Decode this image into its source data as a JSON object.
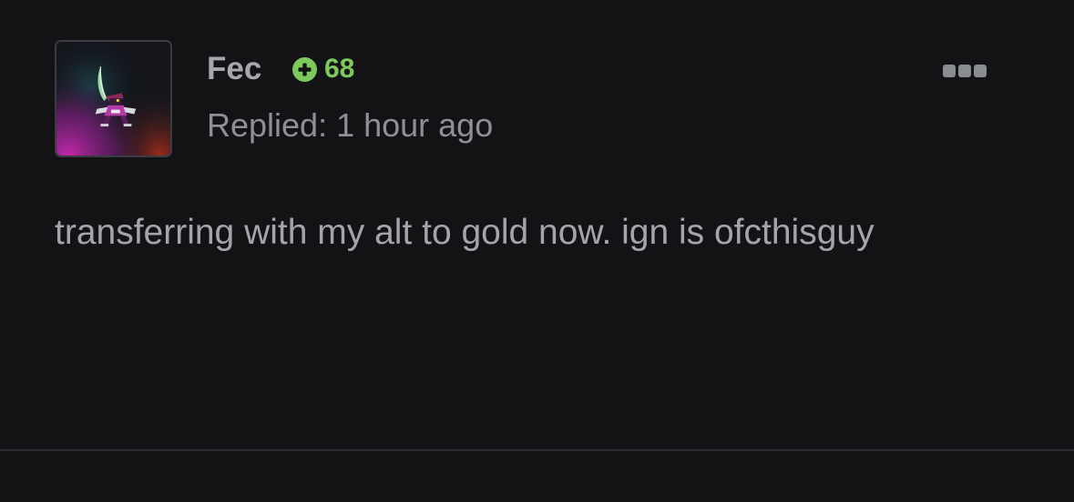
{
  "post": {
    "author": {
      "name": "Fec",
      "reputation": "68"
    },
    "meta": "Replied: 1 hour ago",
    "body": "transferring with my alt to gold now. ign is ofcthisguy"
  },
  "icons": {
    "avatar": "avatar-character-image",
    "reputation": "plus-circle-icon",
    "more": "more-options-icon"
  },
  "colors": {
    "background": "#131316",
    "username": "#a5a8af",
    "reputation": "#7ec95b",
    "meta": "#8e9097",
    "body": "#a3a5ab",
    "divider": "#2a2b30"
  }
}
